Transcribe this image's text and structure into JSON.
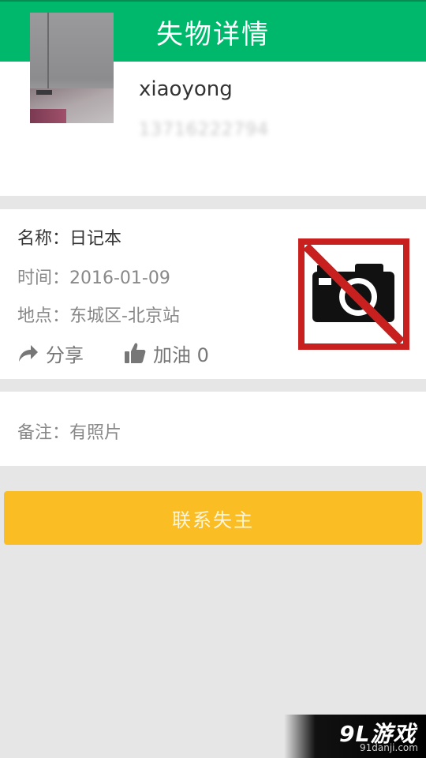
{
  "header": {
    "title": "失物详情"
  },
  "user": {
    "name": "xiaoyong",
    "phone": "13716222794"
  },
  "item": {
    "name_line": "名称：日记本",
    "time_line": "时间：2016-01-09",
    "location_line": "地点：东城区-北京站",
    "no_photo_icon": "no-photo-camera-icon"
  },
  "actions": {
    "share_label": "分享",
    "share_icon": "share-arrow-icon",
    "like_label": "加油 0",
    "like_icon": "thumbs-up-icon"
  },
  "remark": {
    "text": "备注：有照片"
  },
  "contact_button": {
    "label": "联系失主"
  },
  "watermark": {
    "logo": "9L游戏",
    "url": "91danji.com"
  },
  "colors": {
    "header_green": "#00b86b",
    "button_yellow": "#fbbd24",
    "no_photo_red": "#c8201f",
    "background_gray": "#e6e6e6"
  }
}
